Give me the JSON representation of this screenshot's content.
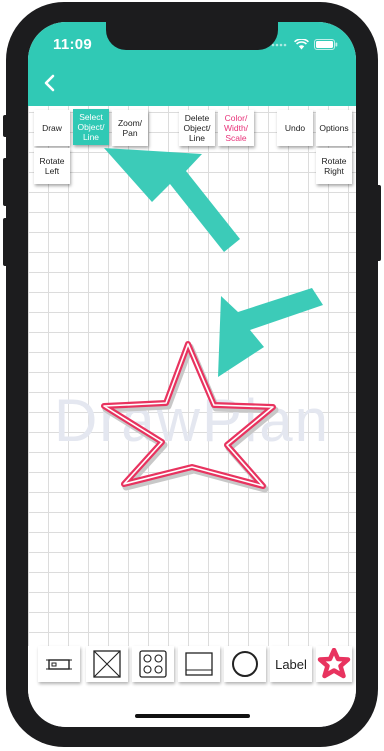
{
  "status": {
    "time": "11:09"
  },
  "toolbar": {
    "draw": "Draw",
    "select_line1": "Select",
    "select_line2": "Object/",
    "select_line3": "Line",
    "zoom_line1": "Zoom/",
    "zoom_line2": "Pan",
    "delete_line1": "Delete",
    "delete_line2": "Object/",
    "delete_line3": "Line",
    "color_line1": "Color/",
    "color_line2": "Width/",
    "color_line3": "Scale",
    "undo": "Undo",
    "options": "Options",
    "rotate_left_line1": "Rotate",
    "rotate_left_line2": "Left",
    "rotate_right_line1": "Rotate",
    "rotate_right_line2": "Right"
  },
  "canvas": {
    "watermark": "DrawPlan"
  },
  "bottom": {
    "label": "Label"
  },
  "colors": {
    "accent": "#30c9b5",
    "pink": "#e8337a",
    "arrow": "#3ccbb8"
  }
}
